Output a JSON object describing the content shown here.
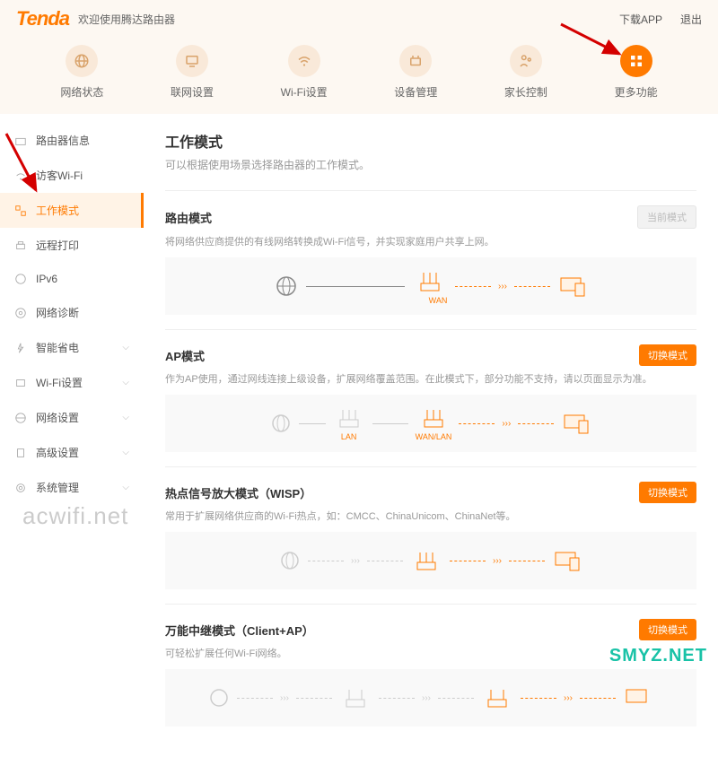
{
  "header": {
    "brand": "Tenda",
    "welcome": "欢迎使用腾达路由器",
    "download_app": "下载APP",
    "logout": "退出"
  },
  "topnav": {
    "items": [
      {
        "label": "网络状态",
        "icon": "globe"
      },
      {
        "label": "联网设置",
        "icon": "monitor"
      },
      {
        "label": "Wi-Fi设置",
        "icon": "wifi"
      },
      {
        "label": "设备管理",
        "icon": "devices"
      },
      {
        "label": "家长控制",
        "icon": "parent"
      },
      {
        "label": "更多功能",
        "icon": "grid",
        "active": true
      }
    ]
  },
  "sidebar": {
    "items": [
      {
        "label": "路由器信息",
        "expandable": false
      },
      {
        "label": "访客Wi-Fi",
        "expandable": false
      },
      {
        "label": "工作模式",
        "active": true,
        "expandable": false
      },
      {
        "label": "远程打印",
        "expandable": false
      },
      {
        "label": "IPv6",
        "expandable": false
      },
      {
        "label": "网络诊断",
        "expandable": false
      },
      {
        "label": "智能省电",
        "expandable": true
      },
      {
        "label": "Wi-Fi设置",
        "expandable": true
      },
      {
        "label": "网络设置",
        "expandable": true
      },
      {
        "label": "高级设置",
        "expandable": true
      },
      {
        "label": "系统管理",
        "expandable": true
      }
    ]
  },
  "main": {
    "title": "工作模式",
    "subtitle": "可以根据使用场景选择路由器的工作模式。",
    "modes": [
      {
        "title": "路由模式",
        "desc": "将网络供应商提供的有线网络转换成Wi-Fi信号，并实现家庭用户共享上网。",
        "btn": "当前模式",
        "btn_style": "disabled",
        "diagram_label": "WAN"
      },
      {
        "title": "AP模式",
        "desc": "作为AP使用，通过网线连接上级设备，扩展网络覆盖范围。在此模式下，部分功能不支持，请以页面显示为准。",
        "btn": "切换模式",
        "btn_style": "orange",
        "diagram_label1": "LAN",
        "diagram_label2": "WAN/LAN"
      },
      {
        "title": "热点信号放大模式（WISP）",
        "desc": "常用于扩展网络供应商的Wi-Fi热点，如：CMCC、ChinaUnicom、ChinaNet等。",
        "btn": "切换模式",
        "btn_style": "orange"
      },
      {
        "title": "万能中继模式（Client+AP）",
        "desc": "可轻松扩展任何Wi-Fi网络。",
        "btn": "切换模式",
        "btn_style": "orange"
      }
    ]
  },
  "watermark": "acwifi.net",
  "watermark2": "SMYZ.NET"
}
